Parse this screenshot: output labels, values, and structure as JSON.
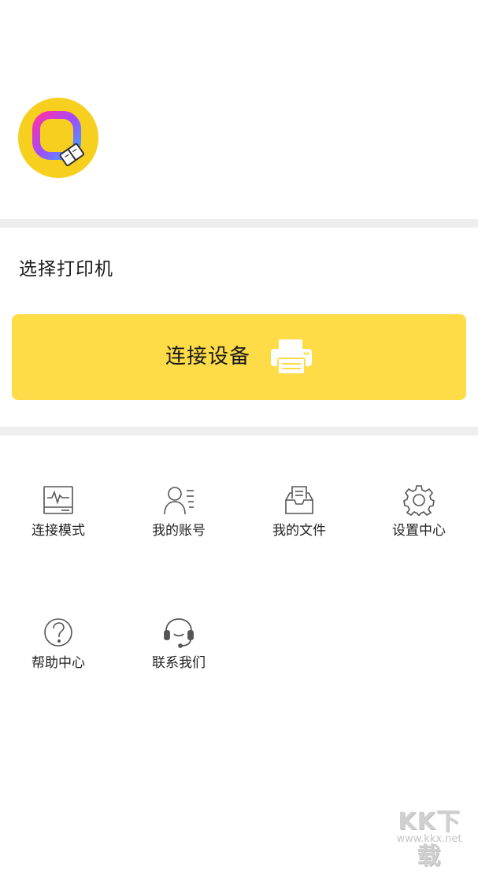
{
  "header": {
    "logo_icon": "app-logo-icon",
    "logo_bg_color": "#F7CF1E"
  },
  "printer_section": {
    "title": "选择打印机",
    "connect_button": {
      "label": "连接设备",
      "icon": "printer-icon",
      "bg_color": "#FDDC47"
    }
  },
  "menu": {
    "items": [
      {
        "label": "连接模式",
        "icon": "monitor-wave-icon"
      },
      {
        "label": "我的账号",
        "icon": "user-list-icon"
      },
      {
        "label": "我的文件",
        "icon": "inbox-document-icon"
      },
      {
        "label": "设置中心",
        "icon": "gear-icon"
      },
      {
        "label": "帮助中心",
        "icon": "question-circle-icon"
      },
      {
        "label": "联系我们",
        "icon": "headset-icon"
      }
    ]
  },
  "watermark": {
    "main": "KK下载",
    "sub": "www.kkx.net"
  }
}
